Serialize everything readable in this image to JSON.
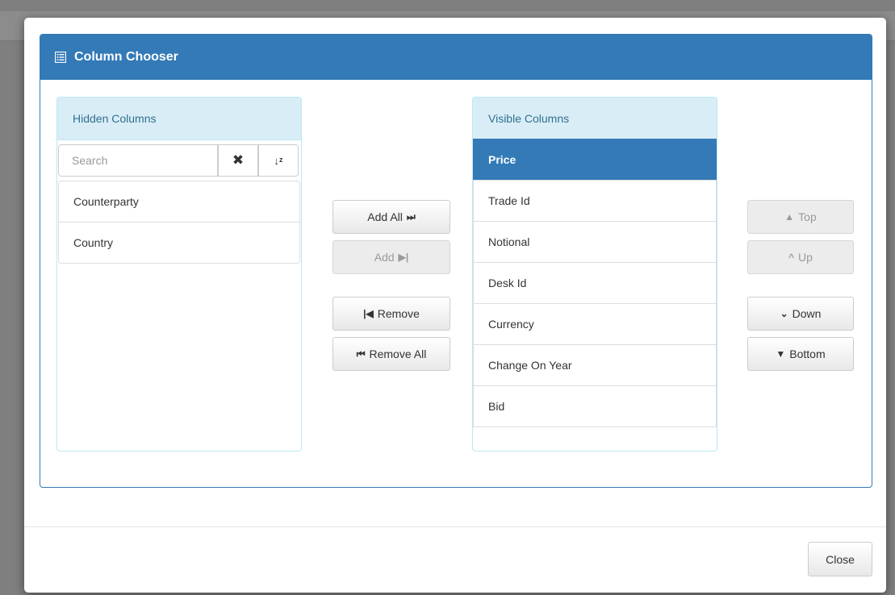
{
  "dialog": {
    "title": "Column Chooser",
    "close_label": "Close"
  },
  "hidden": {
    "title": "Hidden Columns",
    "search_placeholder": "Search",
    "clear_glyph": "✖",
    "sort_glyph": "↓ᶻ",
    "items": [
      "Counterparty",
      "Country"
    ]
  },
  "visible": {
    "title": "Visible Columns",
    "items": [
      "Price",
      "Trade Id",
      "Notional",
      "Desk Id",
      "Currency",
      "Change On Year",
      "Bid"
    ],
    "selected": "Price"
  },
  "transfer": {
    "add_all": "Add All",
    "add_all_glyph": "⏭",
    "add": "Add",
    "add_glyph": "▶|",
    "remove": "Remove",
    "remove_glyph": "|◀",
    "remove_all": "Remove All",
    "remove_all_glyph": "⏮"
  },
  "order": {
    "top": "Top",
    "top_glyph": "▲",
    "up": "Up",
    "up_glyph": "^",
    "down": "Down",
    "down_glyph": "⌄",
    "bottom": "Bottom",
    "bottom_glyph": "▼"
  },
  "colors": {
    "primary": "#337ab7",
    "info_bg": "#d9edf7",
    "info_text": "#31708f"
  }
}
